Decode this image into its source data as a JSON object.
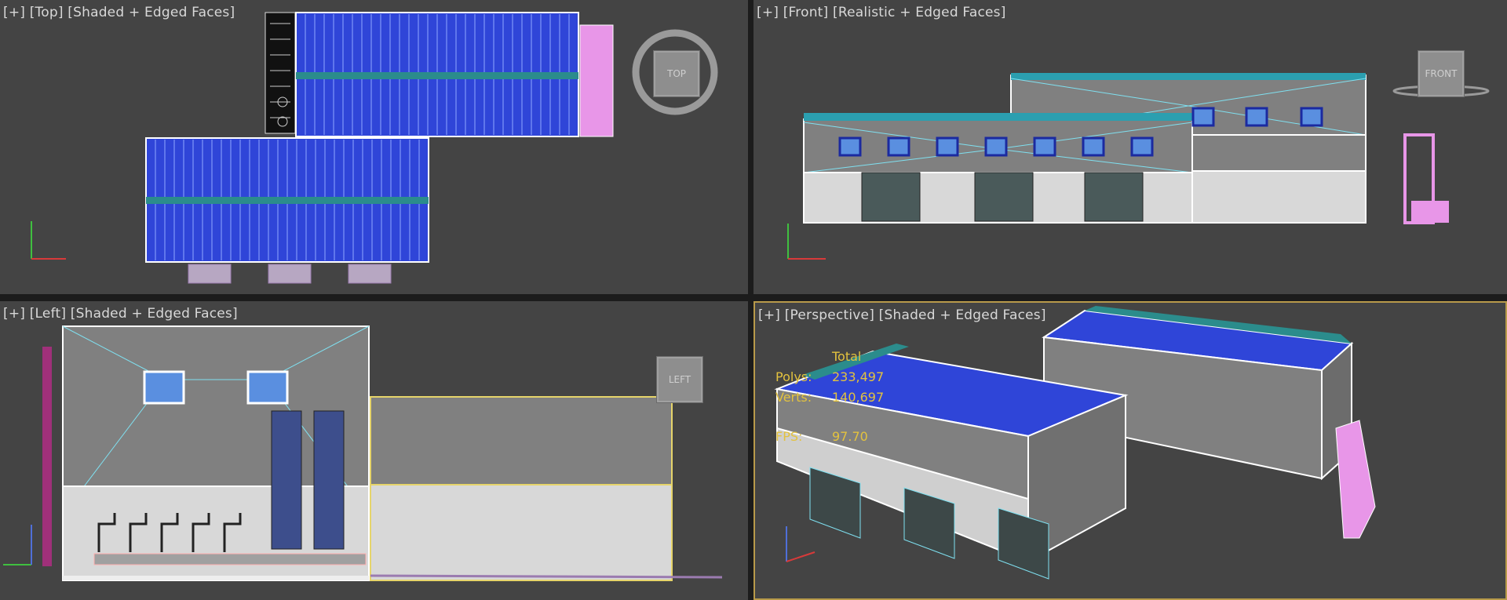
{
  "viewports": {
    "top": {
      "plus": "[+]",
      "view": "[Top]",
      "shading": "[Shaded + Edged Faces]",
      "cube": "TOP"
    },
    "front": {
      "plus": "[+]",
      "view": "[Front]",
      "shading": "[Realistic + Edged Faces]",
      "cube": "FRONT"
    },
    "left": {
      "plus": "[+]",
      "view": "[Left]",
      "shading": "[Shaded + Edged Faces]",
      "cube": "LEFT"
    },
    "persp": {
      "plus": "[+]",
      "view": "[Perspective]",
      "shading": "[Shaded + Edged Faces]"
    }
  },
  "stats": {
    "header": "Total",
    "polys_label": "Polys:",
    "polys_value": "233,497",
    "verts_label": "Verts:",
    "verts_value": "140,697",
    "fps_label": "FPS:",
    "fps_value": "97.70"
  },
  "axes": {
    "x": "x",
    "y": "y",
    "z": "z"
  },
  "colors": {
    "viewport_bg": "#444444",
    "roof_blue": "#2f45d8",
    "roof_panel_line": "#8fa8ff",
    "ridge_teal": "#2b8c8c",
    "wall_grey": "#808080",
    "wall_light": "#d8d8d8",
    "edge_white": "#ffffff",
    "edge_cyan": "#7fe0f0",
    "equipment_pink": "#e896e8",
    "stats_yellow": "#e3c23e",
    "active_border": "#b89a4a"
  }
}
